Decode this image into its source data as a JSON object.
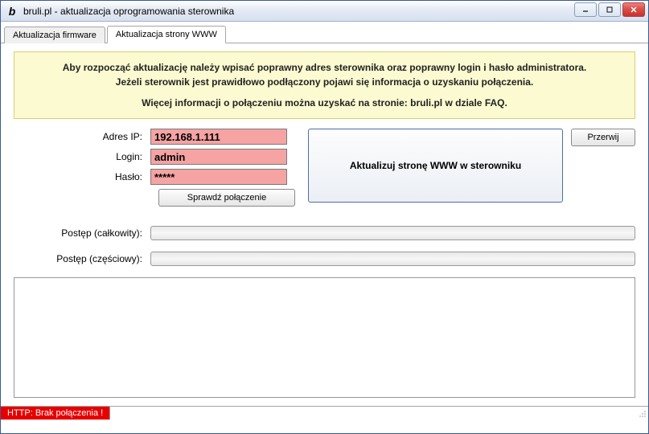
{
  "window": {
    "title": "bruli.pl - aktualizacja oprogramowania sterownika"
  },
  "tabs": {
    "firmware": "Aktualizacja firmware",
    "www": "Aktualizacja strony WWW"
  },
  "info": {
    "line1": "Aby rozpocząć aktualizację należy wpisać poprawny adres sterownika oraz poprawny login i hasło administratora.",
    "line2": "Jeżeli sterownik jest prawidłowo podłączony pojawi się informacja o uzyskaniu połączenia.",
    "line3": "Więcej informacji o połączeniu można uzyskać na stronie: bruli.pl w dziale FAQ."
  },
  "form": {
    "ip_label": "Adres IP:",
    "ip_value": "192.168.1.111",
    "login_label": "Login:",
    "login_value": "admin",
    "password_label": "Hasło:",
    "password_value": "*****",
    "check_btn": "Sprawdź połączenie",
    "update_btn": "Aktualizuj stronę WWW w sterowniku",
    "cancel_btn": "Przerwij"
  },
  "progress": {
    "total_label": "Postęp (całkowity):",
    "partial_label": "Postęp (częściowy):"
  },
  "status": {
    "http": "HTTP: Brak połączenia !"
  }
}
